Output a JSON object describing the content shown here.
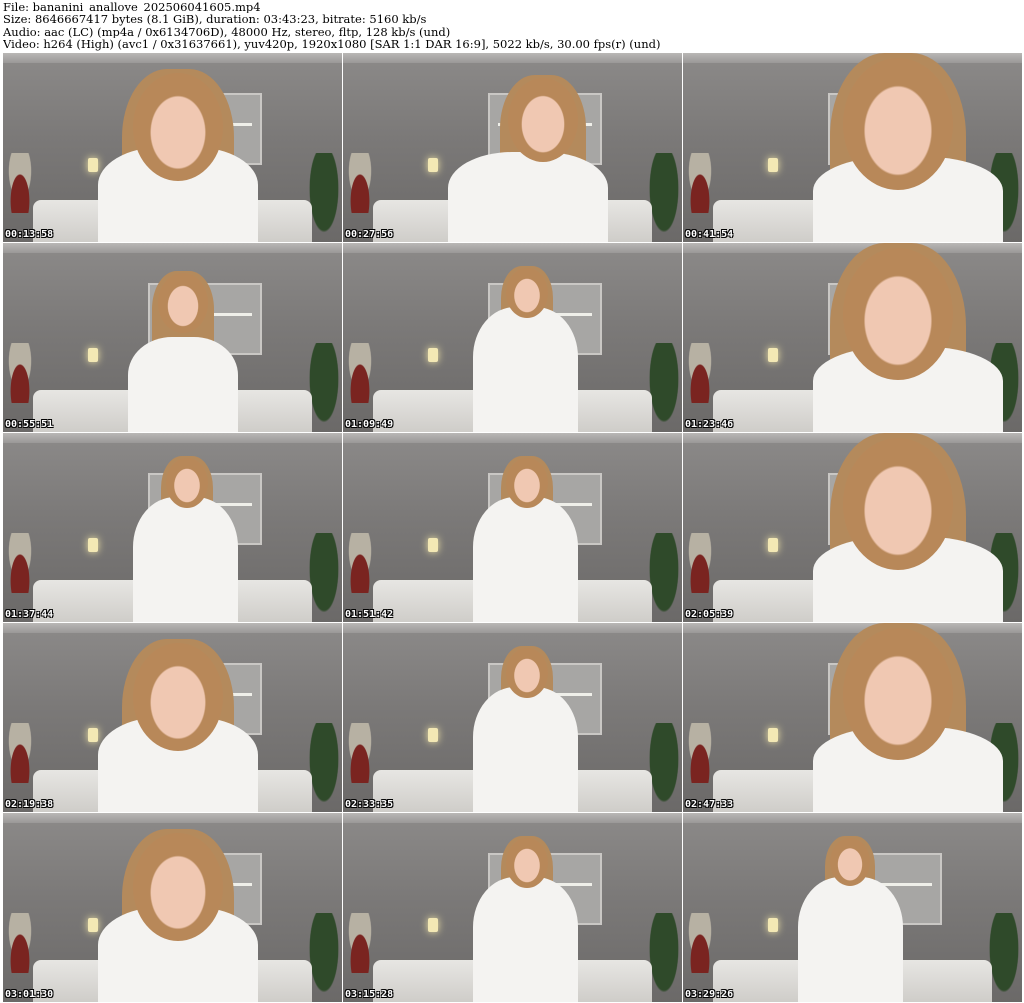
{
  "header": {
    "file_line": "File: bananini_anallove_202506041605.mp4",
    "size_line": "Size: 8646667417 bytes (8.1 GiB), duration: 03:43:23, bitrate: 5160 kb/s",
    "audio_line": "Audio: aac (LC) (mp4a / 0x6134706D), 48000 Hz, stereo, fltp, 128 kb/s (und)",
    "video_line": "Video: h264 (High) (avc1 / 0x31637661), yuv420p, 1920x1080 [SAR 1:1 DAR 16:9], 5022 kb/s, 30.00 fps(r) (und)"
  },
  "thumbnails": [
    {
      "timestamp": "00:13:58",
      "pose": "close"
    },
    {
      "timestamp": "00:27:56",
      "pose": "mid"
    },
    {
      "timestamp": "00:41:54",
      "pose": "closeup-right"
    },
    {
      "timestamp": "00:55:51",
      "pose": "arms-up"
    },
    {
      "timestamp": "01:09:49",
      "pose": "standing"
    },
    {
      "timestamp": "01:23:46",
      "pose": "closeup-right"
    },
    {
      "timestamp": "01:37:44",
      "pose": "standing"
    },
    {
      "timestamp": "01:51:42",
      "pose": "standing"
    },
    {
      "timestamp": "02:05:39",
      "pose": "closeup-right"
    },
    {
      "timestamp": "02:19:38",
      "pose": "close"
    },
    {
      "timestamp": "02:33:35",
      "pose": "standing"
    },
    {
      "timestamp": "02:47:33",
      "pose": "closeup-right"
    },
    {
      "timestamp": "03:01:30",
      "pose": "close"
    },
    {
      "timestamp": "03:15:28",
      "pose": "standing"
    },
    {
      "timestamp": "03:29:26",
      "pose": "standing-right"
    }
  ],
  "colors": {
    "background": "#ffffff",
    "header_text": "#000000",
    "timestamp_text": "#ffffff",
    "timestamp_outline": "#000000"
  }
}
